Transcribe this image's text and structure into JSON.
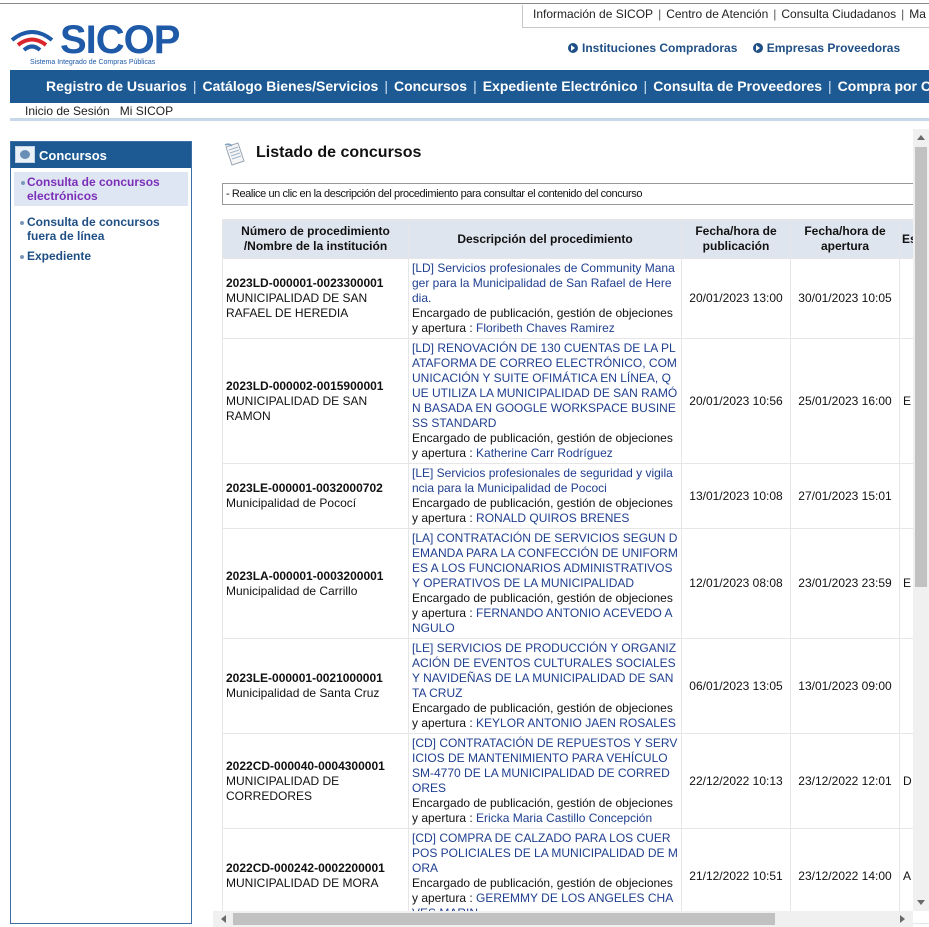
{
  "top_links": [
    "Información de SICOP",
    "Centro de Atención",
    "Consulta Ciudadanos",
    "Ma"
  ],
  "logo": {
    "word": "SICOP",
    "subtitle": "Sistema Integrado de Compras Públicas"
  },
  "quick_links": [
    "Instituciones Compradoras",
    "Empresas Proveedoras"
  ],
  "nav": [
    "Registro de Usuarios",
    "Catálogo Bienes/Servicios",
    "Concursos",
    "Expediente Electrónico",
    "Consulta de Proveedores",
    "Compra por Catál"
  ],
  "subnav": [
    "Inicio de Sesión",
    "Mi SICOP"
  ],
  "sidebar": {
    "title": "Concursos",
    "items": [
      {
        "label": "Consulta de concursos electrónicos",
        "active": true
      },
      {
        "label": "Consulta de concursos fuera de línea",
        "active": false
      },
      {
        "label": "Expediente",
        "active": false
      }
    ]
  },
  "main": {
    "title": "Listado de concursos",
    "hint": "- Realice un clic en la descripción del procedimiento para consultar el contenido del concurso",
    "columns": [
      "Número de procedimiento /Nombre de la institución",
      "Descripción del procedimiento",
      "Fecha/hora de publicación",
      "Fecha/hora de apertura",
      "Es"
    ],
    "rows": [
      {
        "number": "2023LD-000001-0023300001",
        "institution": "MUNICIPALIDAD DE SAN RAFAEL DE HEREDIA",
        "description": "[LD] Servicios profesionales de Community Manager para la Municipalidad de San Rafael de Heredia.",
        "manager_label": "Encargado de publicación, gestión de objeciones y apertura :",
        "manager": "Floribeth Chaves Ramirez",
        "published": "20/01/2023 13:00",
        "opening": "30/01/2023 10:05",
        "status": ""
      },
      {
        "number": "2023LD-000002-0015900001",
        "institution": "MUNICIPALIDAD DE SAN RAMON",
        "description": "[LD] RENOVACIÓN DE 130 CUENTAS DE LA PLATAFORMA DE CORREO ELECTRÓNICO, COMUNICACIÓN Y SUITE OFIMÁTICA EN LÍNEA, QUE UTILIZA LA MUNICIPALIDAD DE SAN RAMÓN BASADA EN GOOGLE WORKSPACE BUSINESS STANDARD",
        "manager_label": "Encargado de publicación, gestión de objeciones y apertura :",
        "manager": "Katherine Carr Rodríguez",
        "published": "20/01/2023 10:56",
        "opening": "25/01/2023 16:00",
        "status": "E"
      },
      {
        "number": "2023LE-000001-0032000702",
        "institution": "Municipalidad de Pococí",
        "description": "[LE] Servicios profesionales de seguridad y vigilancia para la Municipalidad de Pococi",
        "manager_label": "Encargado de publicación, gestión de objeciones y apertura :",
        "manager": "RONALD QUIROS BRENES",
        "published": "13/01/2023 10:08",
        "opening": "27/01/2023 15:01",
        "status": ""
      },
      {
        "number": "2023LA-000001-0003200001",
        "institution": "Municipalidad de Carrillo",
        "description": "[LA] CONTRATACIÓN DE SERVICIOS SEGUN DEMANDA PARA LA CONFECCIÓN DE UNIFORMES A LOS FUNCIONARIOS ADMINISTRATIVOS Y OPERATIVOS DE LA MUNICIPALIDAD",
        "manager_label": "Encargado de publicación, gestión de objeciones y apertura :",
        "manager": "FERNANDO ANTONIO ACEVEDO ANGULO",
        "published": "12/01/2023 08:08",
        "opening": "23/01/2023 23:59",
        "status": "E"
      },
      {
        "number": "2023LE-000001-0021000001",
        "institution": "Municipalidad de Santa Cruz",
        "description": "[LE] SERVICIOS DE PRODUCCIÓN Y ORGANIZACIÓN DE EVENTOS CULTURALES SOCIALES Y NAVIDEÑAS DE LA MUNICIPALIDAD DE SANTA CRUZ",
        "manager_label": "Encargado de publicación, gestión de objeciones y apertura :",
        "manager": "KEYLOR ANTONIO JAEN ROSALES",
        "published": "06/01/2023 13:05",
        "opening": "13/01/2023 09:00",
        "status": ""
      },
      {
        "number": "2022CD-000040-0004300001",
        "institution": "MUNICIPALIDAD DE CORREDORES",
        "description": "[CD] CONTRATACIÓN DE REPUESTOS Y SERVICIOS DE MANTENIMIENTO PARA VEHÍCULO SM-4770 DE LA MUNICIPALIDAD DE CORREDORES",
        "manager_label": "Encargado de publicación, gestión de objeciones y apertura :",
        "manager": "Ericka Maria Castillo Concepción",
        "published": "22/12/2022 10:13",
        "opening": "23/12/2022 12:01",
        "status": "D"
      },
      {
        "number": "2022CD-000242-0002200001",
        "institution": "MUNICIPALIDAD DE MORA",
        "description": "[CD] COMPRA DE CALZADO PARA LOS CUERPOS POLICIALES DE LA MUNICIPALIDAD DE MORA",
        "manager_label": "Encargado de publicación, gestión de objeciones y apertura :",
        "manager": "GEREMMY DE LOS ANGELES CHAVES MARIN",
        "published": "21/12/2022 10:51",
        "opening": "23/12/2022 14:00",
        "status": "A"
      }
    ]
  }
}
